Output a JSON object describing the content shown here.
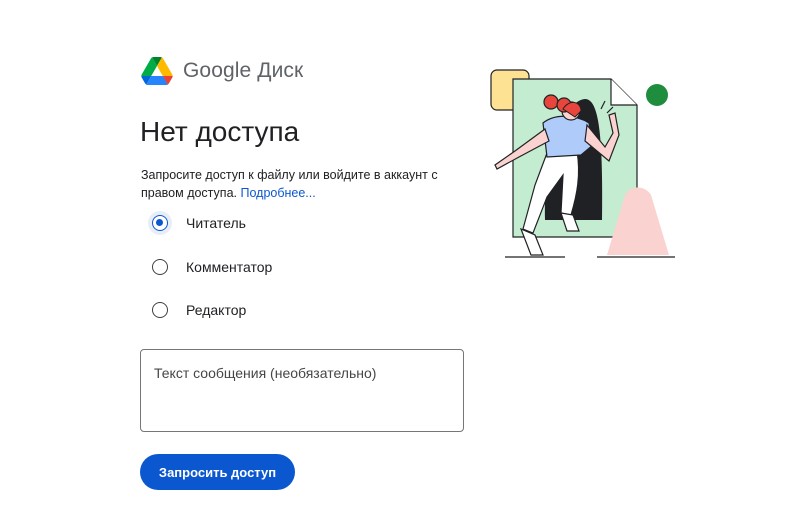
{
  "brand": {
    "logo": "google-drive-logo",
    "name": "Google Диск"
  },
  "page": {
    "title": "Нет доступа",
    "description": "Запросите доступ к файлу или войдите в аккаунт с правом доступа.",
    "learn_more": "Подробнее..."
  },
  "roles": {
    "selected": "viewer",
    "items": [
      {
        "id": "viewer",
        "label": "Читатель",
        "checked": true
      },
      {
        "id": "commenter",
        "label": "Комментатор",
        "checked": false
      },
      {
        "id": "editor",
        "label": "Редактор",
        "checked": false
      }
    ]
  },
  "message": {
    "placeholder": "Текст сообщения (необязательно)",
    "value": ""
  },
  "actions": {
    "request_access": "Запросить доступ"
  },
  "colors": {
    "accent": "#0b57d0",
    "illustration_green": "#c4ecd0",
    "illustration_yellow": "#fde293",
    "illustration_pink": "#fad2cf",
    "illustration_dot": "#1e8e3e",
    "hair_red": "#e8453c",
    "shirt_blue": "#aecbfa"
  },
  "illustration": {
    "name": "person-entering-file-illustration"
  }
}
